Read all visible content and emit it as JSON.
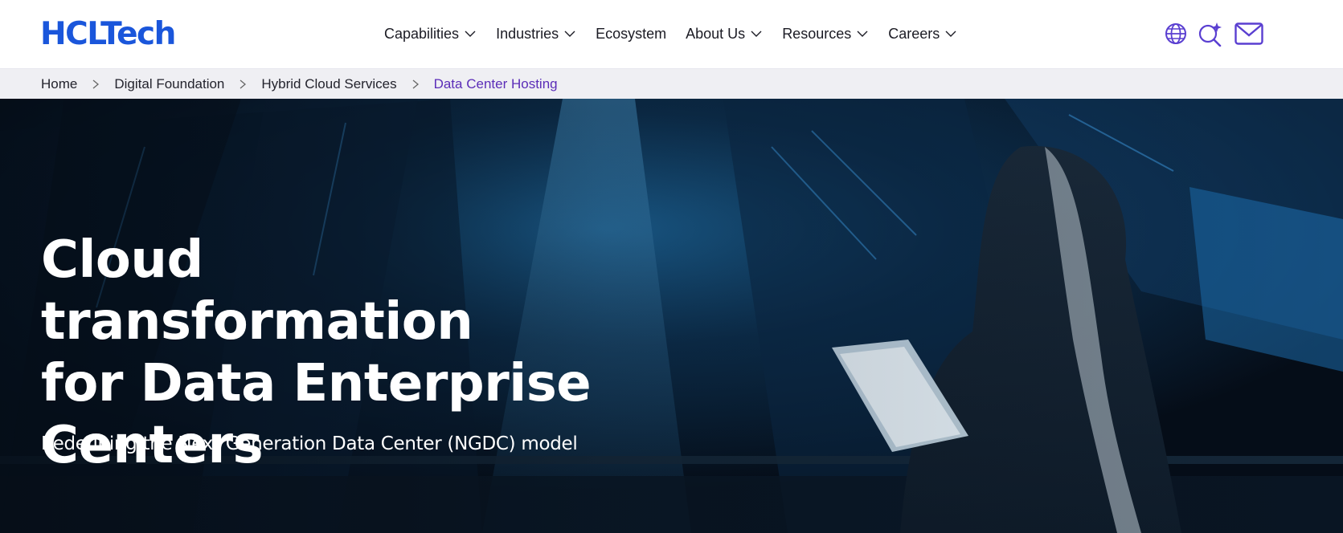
{
  "header": {
    "logo": "HCLTech",
    "nav": [
      {
        "label": "Capabilities",
        "has_dropdown": true
      },
      {
        "label": "Industries",
        "has_dropdown": true
      },
      {
        "label": "Ecosystem",
        "has_dropdown": false
      },
      {
        "label": "About Us",
        "has_dropdown": true
      },
      {
        "label": "Resources",
        "has_dropdown": true
      },
      {
        "label": "Careers",
        "has_dropdown": true
      }
    ],
    "icons": [
      "globe-icon",
      "ai-search-icon",
      "mail-icon"
    ]
  },
  "breadcrumb": {
    "items": [
      "Home",
      "Digital Foundation",
      "Hybrid Cloud Services",
      "Data Center Hosting"
    ]
  },
  "hero": {
    "title_lines": [
      "Cloud transformation",
      "for Data Enterprise",
      "Centers"
    ],
    "subtitle": "Redefining the Next Generation Data Center (NGDC) model"
  },
  "colors": {
    "brand": "#1a56db",
    "icon": "#5a3fd1",
    "breadcrumb_current": "#5b2db8",
    "breadcrumb_bg": "#efeff3",
    "hero_dark": "#06121f",
    "hero_glow": "#1f6fa8"
  }
}
